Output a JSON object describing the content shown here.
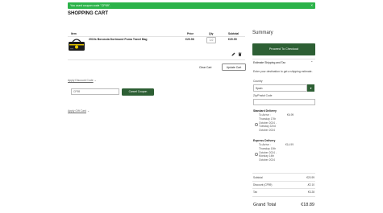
{
  "notice": {
    "message": "You used coupon code \"CP59\".",
    "close": "×"
  },
  "page_title": "SHOPPING CART",
  "cart": {
    "headers": {
      "item": "Item",
      "price": "Price",
      "qty": "Qty",
      "subtotal": "Subtotal"
    },
    "item": {
      "name": "2010s Borussia Dortmund Puma Travel Bag",
      "price": "€20.96",
      "qty": "1.0",
      "subtotal": "€20.99"
    },
    "clear_cart": "Clear Cart",
    "update_cart": "Update Cart"
  },
  "discount": {
    "link": "Apply Discount Code",
    "chevron": "⌄",
    "code_value": "CP59",
    "cancel_label": "Cancel Coupon"
  },
  "gift_card": {
    "link": "Apply Gift Card",
    "chevron": "⌄"
  },
  "summary": {
    "title": "Summary",
    "checkout_label": "Proceed To Checkout",
    "estimate_title": "Estimate Shipping and Tax",
    "estimate_chevron": "⌃",
    "estimate_desc": "Enter your destination to get a shipping estimate.",
    "country_label": "Country",
    "country_value": "Spain",
    "zip_label": "Zip/Postal Code",
    "standard": {
      "title": "Standard Delivery",
      "text": "To Arrive : Thursday 17th October 2024 - Tuesday 22nd October 2024",
      "price": "€6.99"
    },
    "express": {
      "title": "Express Delivery",
      "text": "To Arrive : Thursday 10th October 2024 - Monday 14th October 2024",
      "price": "€14.99"
    },
    "totals": [
      {
        "label": "Subtotal",
        "value": "€20.99"
      },
      {
        "label": "Discount (CP59)",
        "value": "-€2.10"
      },
      {
        "label": "Tax",
        "value": "€3.28"
      }
    ],
    "grand_label": "Grand Total",
    "grand_value": "€18.89"
  },
  "colors": {
    "notice_green": "#2cb34a",
    "button_green": "#2d5f34"
  },
  "icons": {
    "edit": "pencil-icon",
    "delete": "trash-icon",
    "dropdown": "chevron-down-icon"
  }
}
